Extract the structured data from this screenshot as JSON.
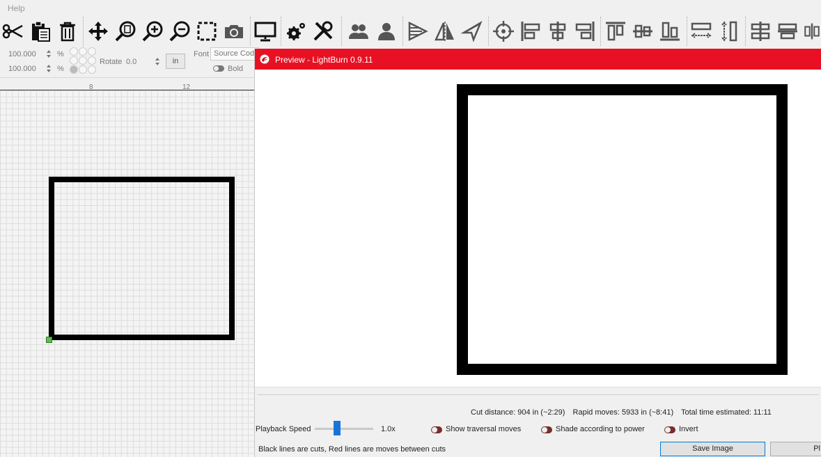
{
  "menu": {
    "help_label": "Help"
  },
  "toolbar": {
    "tools": [
      {
        "name": "cut-tool",
        "icon": "scissors-icon"
      },
      {
        "name": "paste-tool",
        "icon": "clipboard-icon"
      },
      {
        "name": "delete-tool",
        "icon": "trash-icon"
      },
      {
        "name": "move-tool",
        "icon": "move-arrows-icon"
      },
      {
        "name": "zoom-page-tool",
        "icon": "zoom-page-icon"
      },
      {
        "name": "zoom-in-tool",
        "icon": "zoom-in-icon"
      },
      {
        "name": "zoom-out-tool",
        "icon": "zoom-out-icon"
      },
      {
        "name": "frame-selection-tool",
        "icon": "dashed-rect-icon"
      },
      {
        "name": "camera-tool",
        "icon": "camera-icon"
      },
      {
        "name": "monitor-tool",
        "icon": "monitor-icon"
      },
      {
        "name": "settings-tool",
        "icon": "gears-icon"
      },
      {
        "name": "machine-settings-tool",
        "icon": "wrench-screwdriver-icon"
      },
      {
        "name": "group-tool",
        "icon": "group-icon"
      },
      {
        "name": "ungroup-tool",
        "icon": "user-icon"
      },
      {
        "name": "flip-horizontal-tool",
        "icon": "flip-horizontal-icon"
      },
      {
        "name": "mirror-tool",
        "icon": "mirror-icon"
      },
      {
        "name": "rotate-tool",
        "icon": "arrow-rotate-icon"
      },
      {
        "name": "center-tool",
        "icon": "crosshair-icon"
      },
      {
        "name": "align-left-tool",
        "icon": "align-left-icon"
      },
      {
        "name": "align-center-h-tool",
        "icon": "align-center-h-icon"
      },
      {
        "name": "align-right-tool",
        "icon": "align-right-icon"
      },
      {
        "name": "align-top-tool",
        "icon": "align-top-icon"
      },
      {
        "name": "align-middle-tool",
        "icon": "align-middle-icon"
      },
      {
        "name": "align-bottom-tool",
        "icon": "align-bottom-icon"
      },
      {
        "name": "distribute-h-tool",
        "icon": "distribute-h-icon"
      },
      {
        "name": "distribute-v-tool",
        "icon": "distribute-v-icon"
      },
      {
        "name": "space-h-tool",
        "icon": "space-h-icon"
      },
      {
        "name": "space-v-tool",
        "icon": "space-v-icon"
      },
      {
        "name": "more-tool",
        "icon": "more-align-icon"
      }
    ]
  },
  "numbar": {
    "width_value": "100.000",
    "height_value": "100.000",
    "percent_symbol": "%",
    "rotate_label": "Rotate",
    "rotate_value": "0.0",
    "unit_label": "in",
    "font_label": "Font",
    "font_value": "Source Code",
    "bold_label": "Bold"
  },
  "ruler": {
    "ticks": [
      "8",
      "12"
    ]
  },
  "preview": {
    "title": "Preview - LightBurn 0.9.11",
    "cut_distance": "Cut distance: 904 in (~2:29)",
    "rapid_moves": "Rapid moves: 5933 in (~8:41)",
    "total_time": "Total time estimated: 11:11",
    "playback_label": "Playback Speed",
    "playback_speed": "1.0x",
    "playback_fraction": 0.38,
    "show_traversal_label": "Show traversal moves",
    "shade_power_label": "Shade according to power",
    "invert_label": "Invert",
    "legend": "Black lines are cuts, Red lines are moves between cuts",
    "save_image_label": "Save Image",
    "play_label": "Pl"
  },
  "colors": {
    "title_bar": "#e81123",
    "slider_accent": "#1a73d9",
    "toggle_off": "#7a2c2c",
    "selection_handle": "#5cbf4e"
  }
}
